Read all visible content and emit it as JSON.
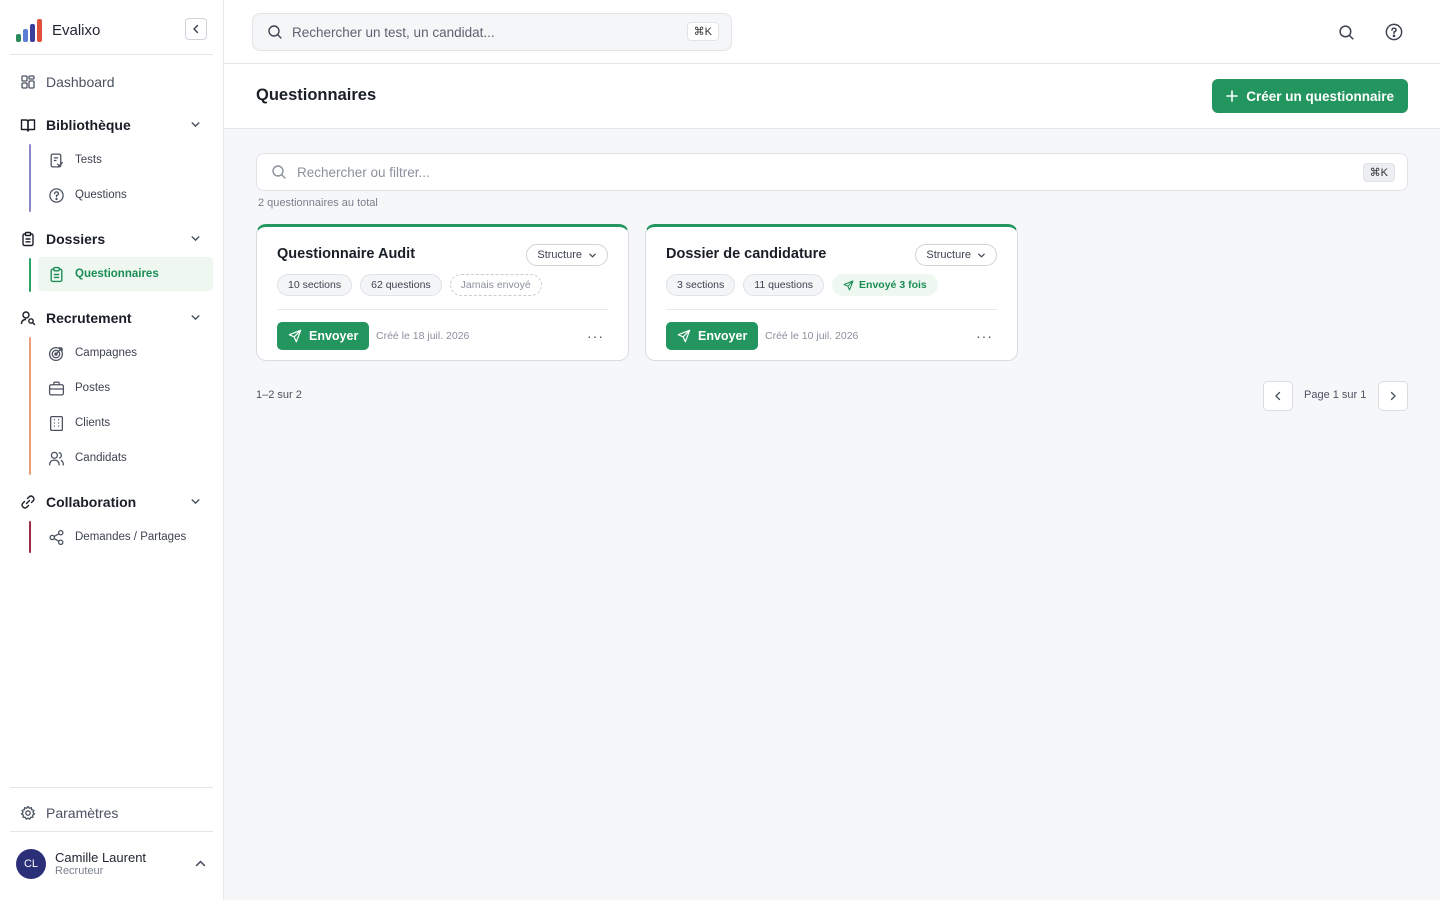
{
  "app": {
    "name": "Evalixo",
    "logo_colors": [
      "#2a8a5b",
      "#5c7fd6",
      "#3a3f9c",
      "#e0503a"
    ]
  },
  "sidebar": {
    "dashboard": {
      "label": "Dashboard",
      "icon": "grid-icon"
    },
    "sections": [
      {
        "label": "Bibliothèque",
        "icon": "book-open-icon",
        "line_color": "#8b86c8",
        "items": [
          {
            "label": "Tests",
            "icon": "checklist-icon"
          },
          {
            "label": "Questions",
            "icon": "help-circle-icon"
          }
        ]
      },
      {
        "label": "Dossiers",
        "icon": "clipboard-icon",
        "line_color": "#2aa567",
        "items": [
          {
            "label": "Questionnaires",
            "icon": "clipboard-list-icon",
            "active": true
          }
        ]
      },
      {
        "label": "Recrutement",
        "icon": "user-search-icon",
        "line_color": "#e9a07a",
        "items": [
          {
            "label": "Campagnes",
            "icon": "target-icon"
          },
          {
            "label": "Postes",
            "icon": "briefcase-icon"
          },
          {
            "label": "Clients",
            "icon": "building-icon"
          },
          {
            "label": "Candidats",
            "icon": "users-icon"
          }
        ]
      },
      {
        "label": "Collaboration",
        "icon": "link-icon",
        "line_color": "#9c2a48",
        "items": [
          {
            "label": "Demandes / Partages",
            "icon": "share-icon"
          }
        ]
      }
    ],
    "settings": {
      "label": "Paramètres",
      "icon": "gear-icon"
    },
    "user": {
      "initials": "CL",
      "name": "Camille Laurent",
      "role": "Recruteur"
    }
  },
  "topbar": {
    "search_placeholder": "Rechercher un test, un candidat...",
    "shortcut": "⌘K"
  },
  "page": {
    "title": "Questionnaires",
    "create_label": "Créer un questionnaire",
    "filter_placeholder": "Rechercher ou filtrer...",
    "filter_shortcut": "⌘K",
    "total_label": "2 questionnaires au total"
  },
  "cards": [
    {
      "title": "Questionnaire Audit",
      "view_label": "Structure",
      "sections": "10 sections",
      "questions": "62 questions",
      "status": "Jamais envoyé",
      "status_type": "never",
      "send_label": "Envoyer",
      "created": "Créé le 18 juil. 2026"
    },
    {
      "title": "Dossier de candidature",
      "view_label": "Structure",
      "sections": "3 sections",
      "questions": "11 questions",
      "status": "Envoyé 3 fois",
      "status_type": "sent",
      "send_label": "Envoyer",
      "created": "Créé le 10 juil. 2026"
    }
  ],
  "pagination": {
    "range": "1–2 sur 2",
    "page_label": "Page 1 sur 1"
  },
  "colors": {
    "accent": "#23955f",
    "accent_light": "#eef8f1"
  }
}
